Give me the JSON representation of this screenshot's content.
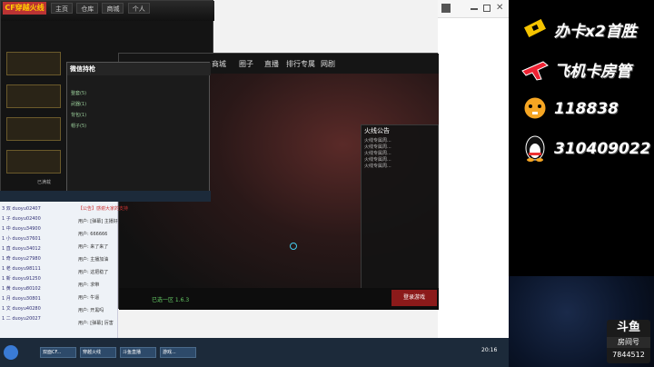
{
  "game": {
    "logo": "CF穿越火线",
    "tabs": [
      "主页",
      "仓库",
      "商城",
      "个人"
    ],
    "status": "已满载"
  },
  "launcher": {
    "nav": [
      "商城",
      "圈子",
      "直播",
      "排行专属",
      "网剧"
    ],
    "notice_title": "火线公告",
    "notice_lines": [
      "火线专属周...",
      "火线专属周...",
      "火线专属周...",
      "火线专属周...",
      "火线专属周..."
    ],
    "status_text": "已选一区 1.6.3",
    "login_label": "登录游戏"
  },
  "overlay": {
    "logo": "微信持枪",
    "rows": [
      "整套(5)",
      "武器(1)",
      "背包(1)",
      "帽子(5)"
    ]
  },
  "chat_list": [
    "3 双 duoyu02407",
    "1 子 duoyu02400",
    "1 中 duoyu34900",
    "1 小 duoyu37601",
    "1 直 duoyu34012",
    "1 奇 duoyu27980",
    "1 老 duoyu98111",
    "1 新 duoyu91250",
    "1 黄 duoyu80102",
    "1 月 duoyu30801",
    "1 文 duoyu40280",
    "1 二 duoyu20027"
  ],
  "messages": [
    "【公告】感谢大家的支持",
    "用户: [弹幕] 主播好",
    "用户: 666666",
    "用户: 来了来了",
    "用户: 主播加油",
    "用户: 这把稳了",
    "用户: 求带",
    "用户: 牛逼",
    "用户: 开黑吗",
    "用户: [弹幕] 厉害"
  ],
  "taskbar": {
    "items": [
      "双面CF...",
      "穿越火线",
      "斗鱼直播",
      "游戏..."
    ],
    "clock": "20:16"
  },
  "promo": {
    "line1": "办卡x2首胜",
    "line2": "飞机卡房管",
    "line3": "118838",
    "line4": "310409022"
  },
  "douyu": {
    "logo": "斗鱼",
    "room_label": "房间号",
    "room_number": "7844512"
  },
  "colors": {
    "promo_bg": "#000000",
    "accent_red": "#8b1a1a",
    "taskbar": "#1c2a3a"
  }
}
